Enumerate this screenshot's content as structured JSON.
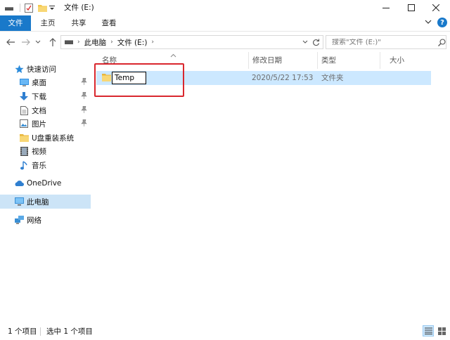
{
  "window": {
    "title": "文件 (E:)",
    "controls": {
      "minimize": "—",
      "maximize": "☐",
      "close": "✕"
    }
  },
  "ribbon": {
    "tabs": [
      "文件",
      "主页",
      "共享",
      "查看"
    ],
    "help": "?"
  },
  "address": {
    "crumbs": [
      "此电脑",
      "文件 (E:)"
    ],
    "search_placeholder": "搜索\"文件 (E:)\""
  },
  "sidebar": {
    "items": [
      {
        "label": "快速访问",
        "icon": "star-icon"
      },
      {
        "label": "桌面",
        "icon": "desktop-icon",
        "pinned": true
      },
      {
        "label": "下载",
        "icon": "download-icon",
        "pinned": true
      },
      {
        "label": "文档",
        "icon": "document-icon",
        "pinned": true
      },
      {
        "label": "图片",
        "icon": "picture-icon",
        "pinned": true
      },
      {
        "label": "U盘重装系统",
        "icon": "folder-icon"
      },
      {
        "label": "视频",
        "icon": "video-icon"
      },
      {
        "label": "音乐",
        "icon": "music-icon"
      },
      {
        "label": "OneDrive",
        "icon": "cloud-icon"
      },
      {
        "label": "此电脑",
        "icon": "pc-icon",
        "selected": true
      },
      {
        "label": "网络",
        "icon": "network-icon"
      }
    ]
  },
  "columns": [
    "名称",
    "修改日期",
    "类型",
    "大小"
  ],
  "files": [
    {
      "name": "Temp",
      "modified": "2020/5/22 17:53",
      "type": "文件夹",
      "size": ""
    }
  ],
  "status": {
    "count": "1 个项目",
    "selected": "选中 1 个项目"
  },
  "colors": {
    "accent": "#1979ca",
    "selection": "#cce8ff",
    "highlight_border": "#d9272e",
    "folder": "#f3c74b"
  }
}
